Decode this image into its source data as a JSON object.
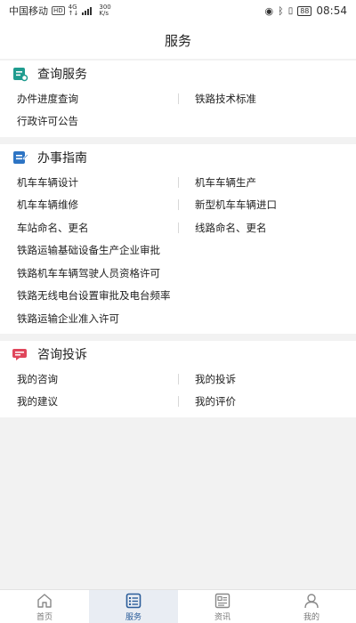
{
  "status_bar": {
    "carrier": "中国移动",
    "hd": "HD",
    "net_top": "4G",
    "net_bottom": "↑↓",
    "speed_value": "300",
    "speed_unit": "K/s",
    "battery": "88",
    "time": "08:54"
  },
  "header": {
    "title": "服务"
  },
  "sections": [
    {
      "title": "查询服务",
      "icon": "search-document-icon",
      "rows": [
        [
          "办件进度查询",
          "铁路技术标准"
        ],
        [
          "行政许可公告"
        ]
      ]
    },
    {
      "title": "办事指南",
      "icon": "guide-document-icon",
      "rows": [
        [
          "机车车辆设计",
          "机车车辆生产"
        ],
        [
          "机车车辆维修",
          "新型机车车辆进口"
        ],
        [
          "车站命名、更名",
          "线路命名、更名"
        ],
        [
          "铁路运输基础设备生产企业审批"
        ],
        [
          "铁路机车车辆驾驶人员资格许可"
        ],
        [
          "铁路无线电台设置审批及电台频率"
        ],
        [
          "铁路运输企业准入许可"
        ]
      ]
    },
    {
      "title": "咨询投诉",
      "icon": "chat-bubble-icon",
      "rows": [
        [
          "我的咨询",
          "我的投诉"
        ],
        [
          "我的建议",
          "我的评价"
        ]
      ]
    }
  ],
  "tabs": [
    {
      "label": "首页",
      "icon": "home-icon",
      "active": false
    },
    {
      "label": "服务",
      "icon": "service-list-icon",
      "active": true
    },
    {
      "label": "资讯",
      "icon": "news-icon",
      "active": false
    },
    {
      "label": "我的",
      "icon": "user-icon",
      "active": false
    }
  ],
  "colors": {
    "accent": "#2b5d9a",
    "icon_teal": "#1f9c8f",
    "icon_blue": "#2d74c4",
    "icon_red": "#e0465b"
  }
}
